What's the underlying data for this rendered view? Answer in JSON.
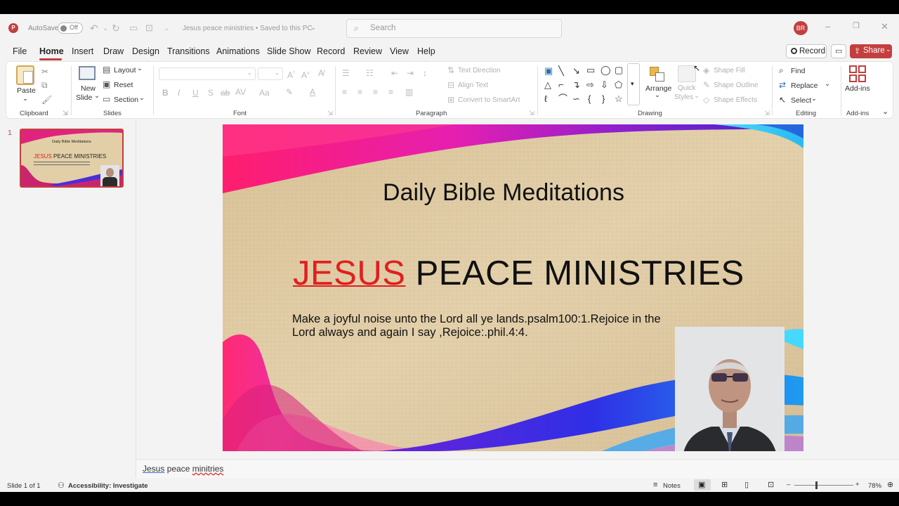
{
  "app": {
    "autosave_label": "AutoSave",
    "autosave_state": "Off",
    "document_title": "Jesus peace ministries • Saved to this PC",
    "search_placeholder": "Search",
    "user_initials": "BR",
    "accent_color": "#c43e3e"
  },
  "menu": {
    "items": [
      "File",
      "Home",
      "Insert",
      "Draw",
      "Design",
      "Transitions",
      "Animations",
      "Slide Show",
      "Record",
      "Review",
      "View",
      "Help"
    ],
    "active": "Home",
    "record_label": "Record",
    "share_label": "Share"
  },
  "ribbon": {
    "clipboard": {
      "paste": "Paste",
      "group": "Clipboard"
    },
    "slides": {
      "new_slide_1": "New",
      "new_slide_2": "Slide",
      "layout": "Layout",
      "reset": "Reset",
      "section": "Section",
      "group": "Slides"
    },
    "font": {
      "bold": "B",
      "italic": "I",
      "underline": "U",
      "strike": "S",
      "group": "Font"
    },
    "paragraph": {
      "text_direction": "Text Direction",
      "align_text": "Align Text",
      "convert_smartart": "Convert to SmartArt",
      "group": "Paragraph"
    },
    "drawing": {
      "arrange": "Arrange",
      "quick_styles_1": "Quick",
      "quick_styles_2": "Styles",
      "shape_fill": "Shape Fill",
      "shape_outline": "Shape Outline",
      "shape_effects": "Shape Effects",
      "group": "Drawing"
    },
    "editing": {
      "find": "Find",
      "replace": "Replace",
      "select": "Select",
      "group": "Editing"
    },
    "addins": {
      "label": "Add-ins",
      "group": "Add-ins"
    }
  },
  "thumbnails": [
    {
      "number": "1",
      "title": "Daily Bible Meditations",
      "heading_red": "JESUS",
      "heading_rest": "PEACE MINISTRIES"
    }
  ],
  "slide": {
    "title": "Daily Bible Meditations",
    "heading_red": "JESUS",
    "heading_rest": "PEACE MINISTRIES",
    "body_line1": "Make a joyful noise unto the Lord all ye lands.psalm100:1.Rejoice in the",
    "body_line2": "Lord always and again I say ,Rejoice:.phil.4:4."
  },
  "notes": {
    "w1": "Jesus",
    "w2": "peace",
    "w3": "minitries"
  },
  "status": {
    "slide_count": "Slide 1 of 1",
    "accessibility": "Accessibility: Investigate",
    "notes_label": "Notes",
    "zoom_level": "78%",
    "zoom_minus": "–",
    "zoom_plus": "+"
  }
}
